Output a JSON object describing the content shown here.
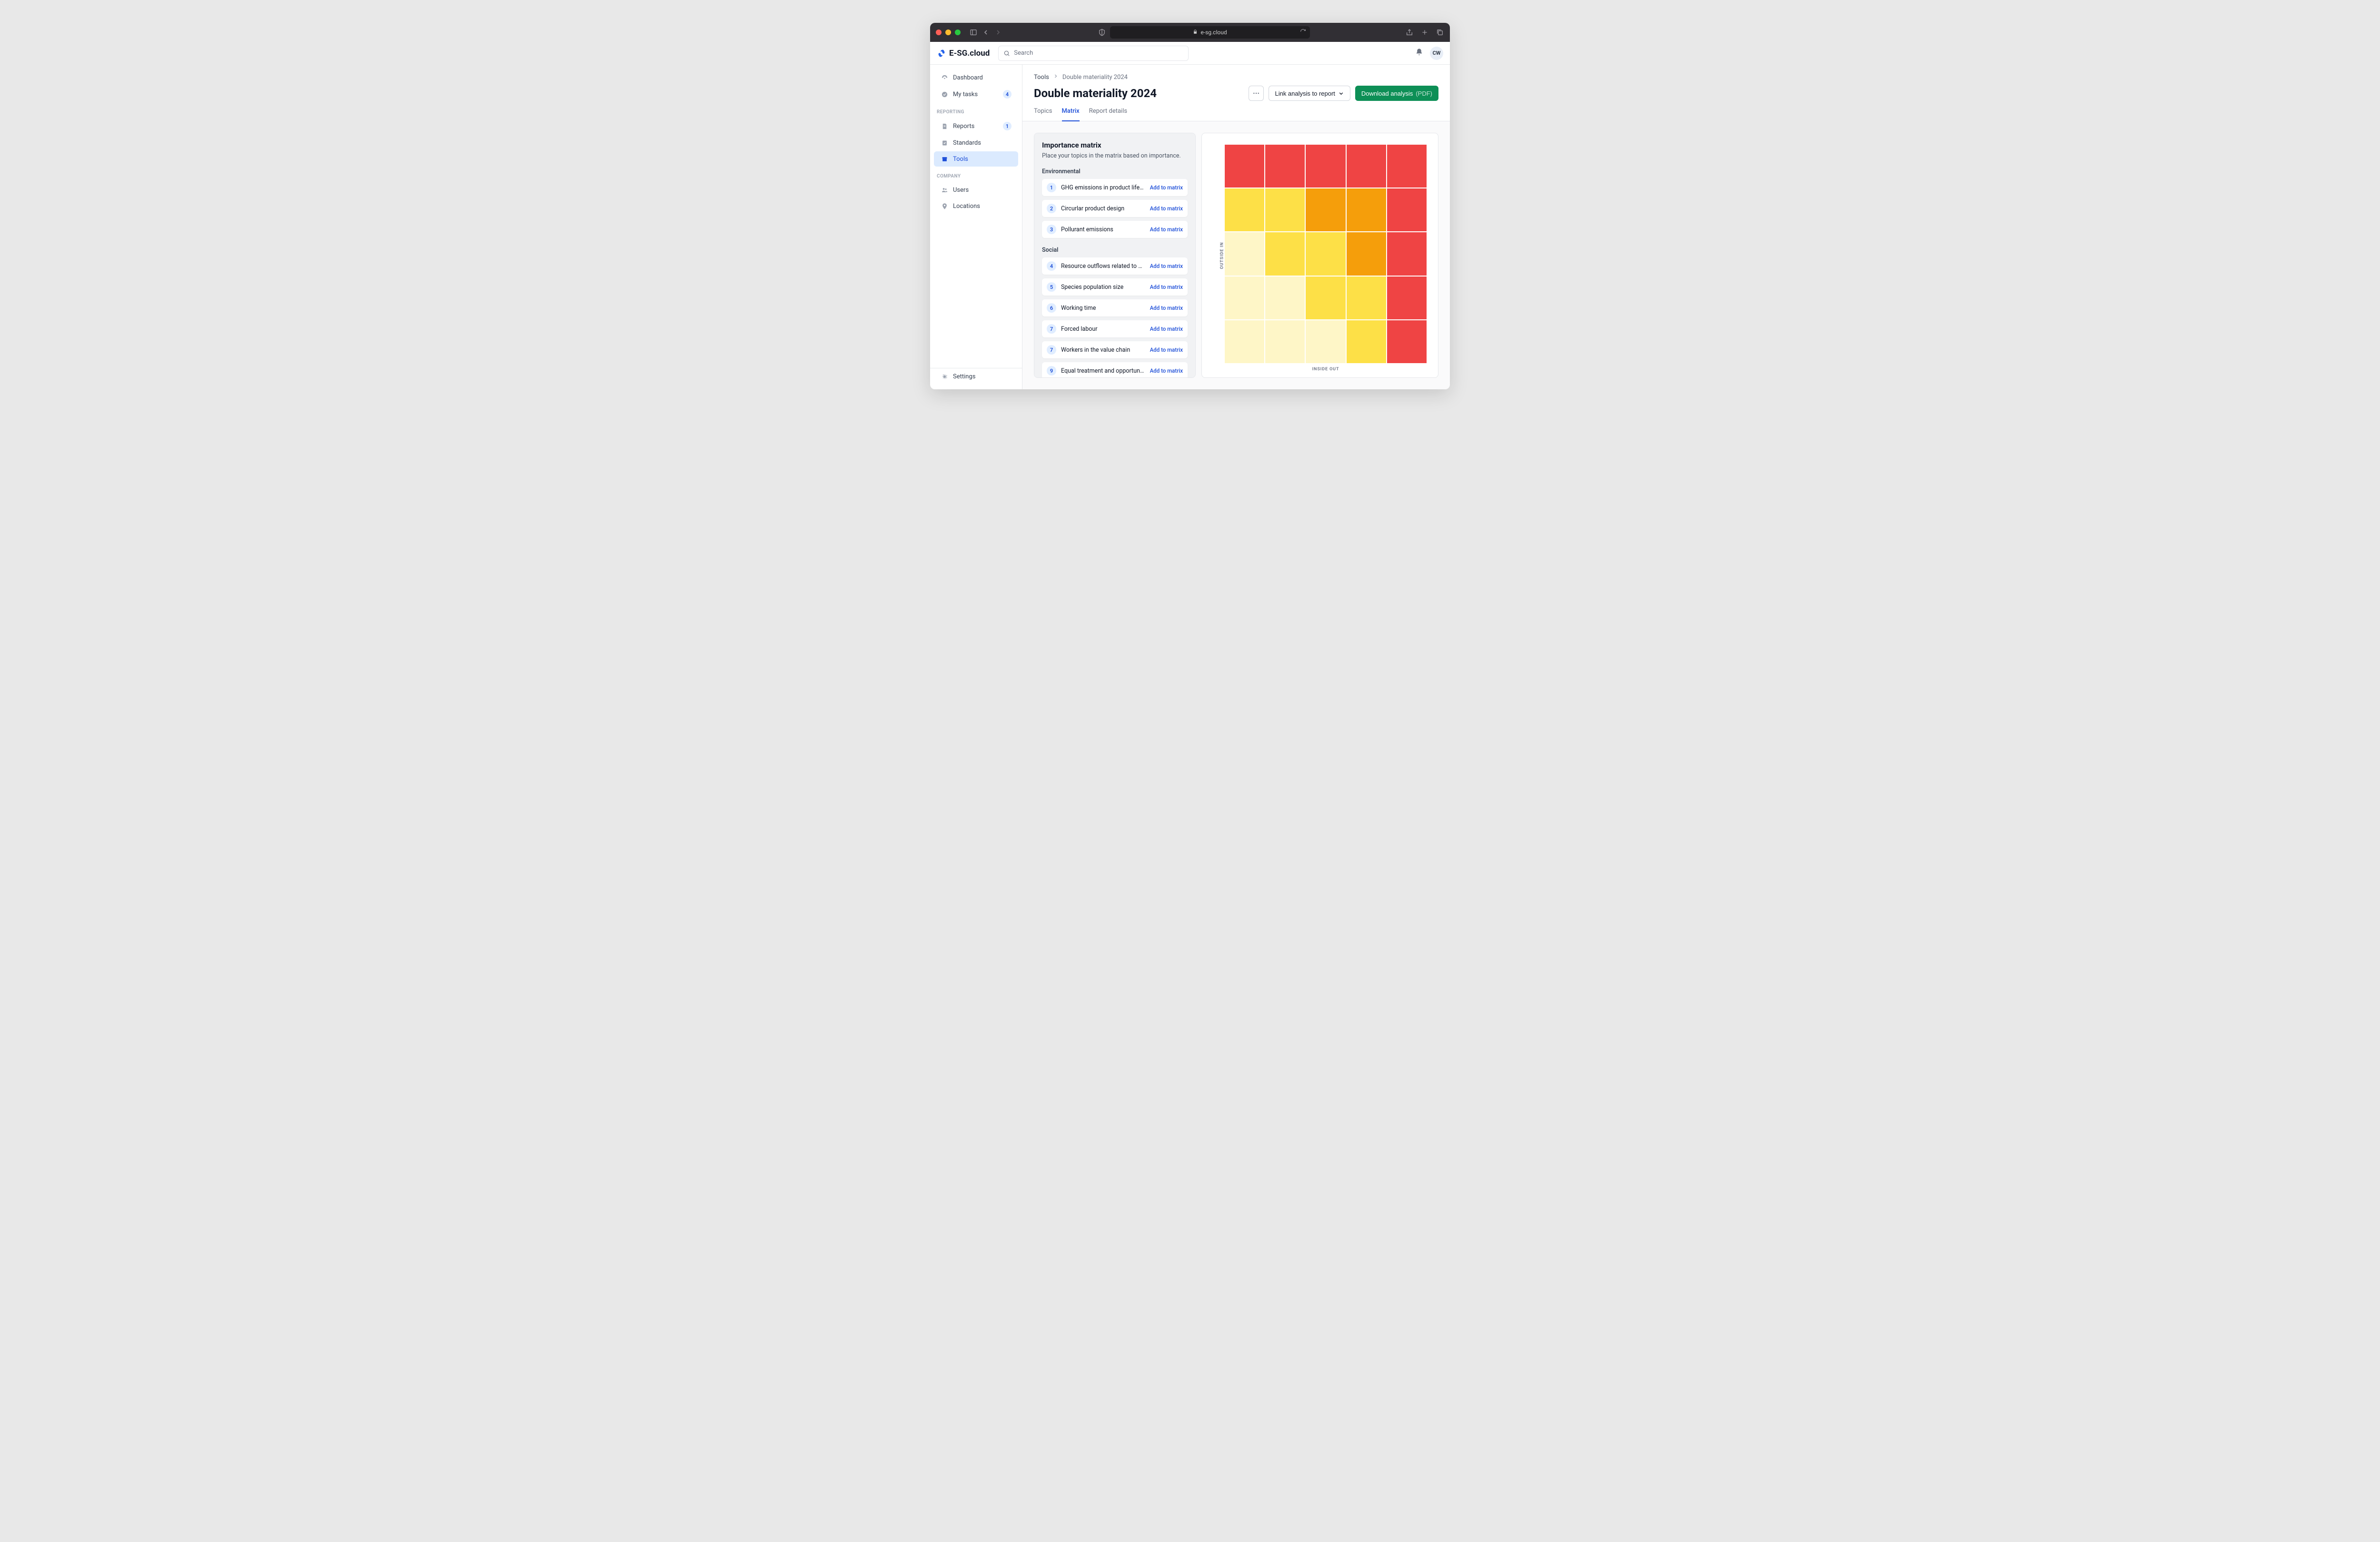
{
  "chrome": {
    "url": "e-sg.cloud"
  },
  "header": {
    "brand": "E-SG.cloud",
    "search_placeholder": "Search",
    "avatar_initials": "CW"
  },
  "sidebar": {
    "top": [
      {
        "icon": "dashboard",
        "label": "Dashboard",
        "badge": null,
        "active": false
      },
      {
        "icon": "check",
        "label": "My tasks",
        "badge": "4",
        "active": false
      }
    ],
    "sections": [
      {
        "heading": "REPORTING",
        "items": [
          {
            "icon": "report",
            "label": "Reports",
            "badge": "1",
            "active": false
          },
          {
            "icon": "standard",
            "label": "Standards",
            "badge": null,
            "active": false
          },
          {
            "icon": "tools",
            "label": "Tools",
            "badge": null,
            "active": true
          }
        ]
      },
      {
        "heading": "COMPANY",
        "items": [
          {
            "icon": "users",
            "label": "Users",
            "badge": null,
            "active": false
          },
          {
            "icon": "location",
            "label": "Locations",
            "badge": null,
            "active": false
          }
        ]
      }
    ],
    "footer": {
      "icon": "settings",
      "label": "Settings"
    }
  },
  "breadcrumb": {
    "parent": "Tools",
    "current": "Double materiality 2024"
  },
  "page": {
    "title": "Double materiality 2024",
    "link_btn": "Link analysis to report",
    "download_btn": "Download analysis",
    "download_hint": "(PDF)"
  },
  "tabs": [
    "Topics",
    "Matrix",
    "Report details"
  ],
  "active_tab": "Matrix",
  "panel": {
    "title": "Importance matrix",
    "desc": "Place your topics in the matrix based on importance.",
    "add_label": "Add to matrix",
    "groups": [
      {
        "name": "Environmental",
        "topics": [
          {
            "n": "1",
            "name": "GHG emissions in product lifecycle (s…"
          },
          {
            "n": "2",
            "name": "Circurlar product design"
          },
          {
            "n": "3",
            "name": "Pollurant emissions"
          }
        ]
      },
      {
        "name": "Social",
        "topics": [
          {
            "n": "4",
            "name": "Resource outflows related to product…"
          },
          {
            "n": "5",
            "name": "Species population size"
          },
          {
            "n": "6",
            "name": "Working time"
          },
          {
            "n": "7",
            "name": "Forced labour"
          },
          {
            "n": "7",
            "name": "Workers in the value chain"
          },
          {
            "n": "9",
            "name": "Equal treatment and opportunities for…"
          }
        ]
      }
    ]
  },
  "chart_data": {
    "type": "heatmap",
    "xlabel": "INSIDE OUT",
    "ylabel": "OUTSIDE IN",
    "rows": 5,
    "cols": 5,
    "palette": {
      "1": "#fef6c7",
      "2": "#fde047",
      "3": "#f59e0b",
      "4": "#ef4444"
    },
    "cells": [
      [
        4,
        4,
        4,
        4,
        4
      ],
      [
        2,
        2,
        3,
        3,
        4
      ],
      [
        1,
        2,
        2,
        3,
        4
      ],
      [
        1,
        1,
        2,
        2,
        4
      ],
      [
        1,
        1,
        1,
        2,
        4
      ]
    ]
  }
}
